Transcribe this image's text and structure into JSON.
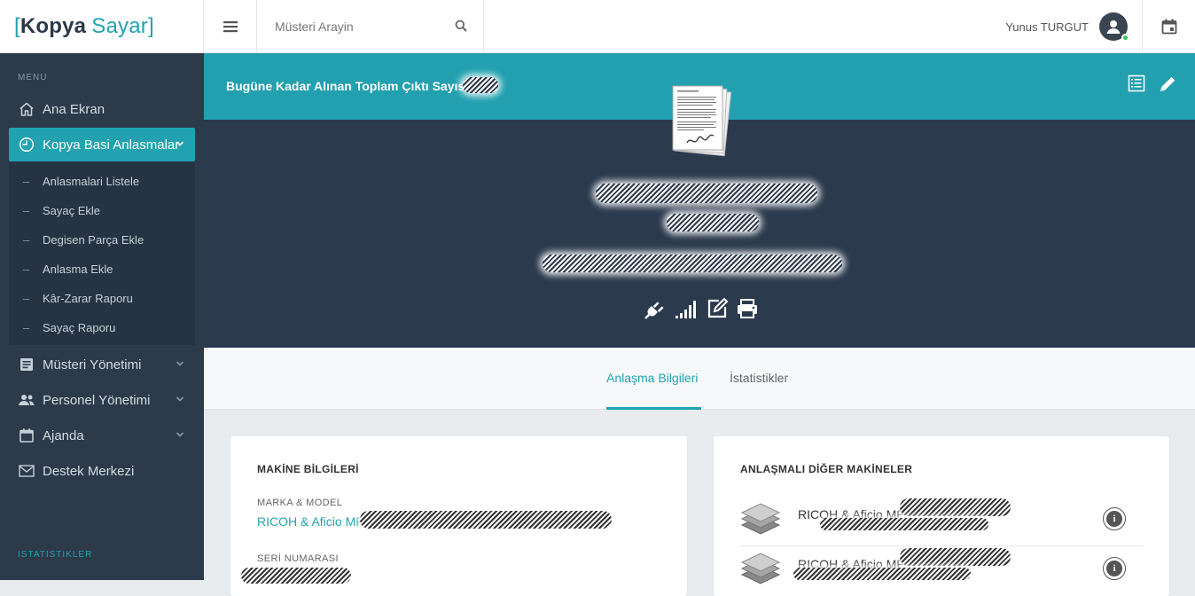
{
  "brand": {
    "open": "[",
    "name_a": "Kopya",
    "name_b": "Sayar",
    "close": "]"
  },
  "search": {
    "placeholder": "Müsteri Arayin"
  },
  "user": {
    "name": "Yunus TURGUT"
  },
  "sidebar": {
    "heading": "MENU",
    "items": [
      {
        "label": "Ana Ekran",
        "icon": "home-icon"
      },
      {
        "label": "Kopya Basi Anlasmalar",
        "icon": "clock-icon"
      },
      {
        "label": "Müsteri Yönetimi",
        "icon": "document-icon"
      },
      {
        "label": "Personel Yönetimi",
        "icon": "users-icon"
      },
      {
        "label": "Ajanda",
        "icon": "calendar-icon"
      },
      {
        "label": "Destek Merkezi",
        "icon": "envelope-icon"
      }
    ],
    "submenu": [
      {
        "label": "Anlasmalari Listele"
      },
      {
        "label": "Sayaç Ekle"
      },
      {
        "label": "Degisen Parça Ekle"
      },
      {
        "label": "Anlasma Ekle"
      },
      {
        "label": "Kâr-Zarar Raporu"
      },
      {
        "label": "Sayaç Raporu"
      }
    ],
    "footer": "ISTATISTIKLER",
    "dash": "–"
  },
  "banner": {
    "title": "Bugüne Kadar Alınan Toplam Çıktı Sayısı :"
  },
  "tabs": [
    {
      "label": "Anlaşma Bilgileri",
      "active": true
    },
    {
      "label": "İstatistikler",
      "active": false
    }
  ],
  "machine_info": {
    "title": "MAKİNE BİLGİLERİ",
    "brand_model_label": "MARKA & MODEL",
    "brand_model_value": "RICOH & Aficio MP",
    "serial_label": "SERİ NUMARASI"
  },
  "other_machines": {
    "title": "ANLAŞMALI DİĞER MAKİNELER",
    "rows": [
      {
        "name": "RICOH & Aficio MP"
      },
      {
        "name": "RICOH & Aficio MP"
      }
    ],
    "info_glyph": "i"
  },
  "colors": {
    "accent": "#22a2b0",
    "sidebar": "#2c3a4a",
    "hero": "#2c3a4e"
  }
}
